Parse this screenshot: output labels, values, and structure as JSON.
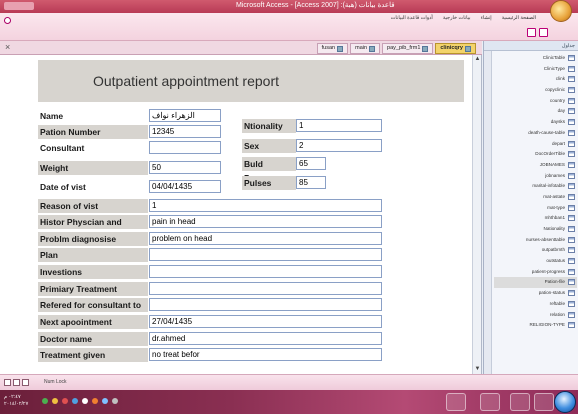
{
  "window": {
    "title": "Microsoft Access - [Access 2007] :قاعدة بيانات (هبة)"
  },
  "ribbon": {
    "tabs": [
      "الصفحة الرئيسية",
      "إنشاء",
      "بيانات خارجية",
      "أدوات قاعدة البيانات"
    ]
  },
  "doc_tabs": [
    {
      "label": "clinicqry",
      "active": true
    },
    {
      "label": "pay_pib_frm1",
      "active": false
    },
    {
      "label": "main",
      "active": false
    },
    {
      "label": "fusan",
      "active": false
    }
  ],
  "report": {
    "title": "Outpatient appointment report",
    "labels": {
      "name": "Name",
      "pation_number": "Pation Number",
      "consultant": "Consultant",
      "weight": "Weight",
      "date_of_visit": "Date of vist",
      "reason_of_visit": "Reason of vist",
      "history": "Histor Physcian and invistigation",
      "problem": "Problm diagnosise",
      "plan": "Plan",
      "investions": "Investions",
      "primary_treatment": "Primiary Treatment",
      "referred": "Refered  for consultant to",
      "next_appointment": "Next apoointment",
      "doctor_name": "Doctor name",
      "treatment_given": "Treatment given",
      "nationality": "Ntionality",
      "sex": "Sex",
      "blood_pressure": "Buld Pressure",
      "pulses": "Pulses"
    },
    "values": {
      "name": "الزهراء نواف",
      "pation_number": "12345",
      "consultant": "",
      "weight": "50",
      "date_of_visit": "04/04/1435",
      "reason_of_visit": "1",
      "history": "pain in head",
      "problem": "problem on head",
      "plan": "",
      "investions": "",
      "primary_treatment": "",
      "referred": "",
      "next_appointment": "27/04/1435",
      "doctor_name": "dr.ahmed",
      "treatment_given": "no treat befor",
      "nationality": "1",
      "sex": "2",
      "blood_pressure": "65",
      "pulses": "85"
    }
  },
  "nav": {
    "header": "جداول",
    "items": [
      {
        "label": "ClinicTable"
      },
      {
        "label": "ClinicType"
      },
      {
        "label": "clink"
      },
      {
        "label": "copyclinic"
      },
      {
        "label": "country"
      },
      {
        "label": "day"
      },
      {
        "label": "daysks"
      },
      {
        "label": "death-cause-table"
      },
      {
        "label": "depart"
      },
      {
        "label": "DocOrderTible"
      },
      {
        "label": "JOBNAMES"
      },
      {
        "label": "jobnames"
      },
      {
        "label": "marital-infotable"
      },
      {
        "label": "mat-astate"
      },
      {
        "label": "mat-type"
      },
      {
        "label": "mhthban1"
      },
      {
        "label": "Nationality"
      },
      {
        "label": "nurses-absenttable"
      },
      {
        "label": "outpatbrnth"
      },
      {
        "label": "outstatus"
      },
      {
        "label": "patient-progress"
      },
      {
        "label": "Pation-file",
        "selected": true
      },
      {
        "label": "pation-status"
      },
      {
        "label": "reftable"
      },
      {
        "label": "relation"
      },
      {
        "label": "RELIGION-TYPE"
      }
    ]
  },
  "statusbar": {
    "text": "Num Lock"
  },
  "taskbar": {
    "time": "٠٢:٤٧ م",
    "date": "٢٠١٤/٠٢/٢٧"
  }
}
